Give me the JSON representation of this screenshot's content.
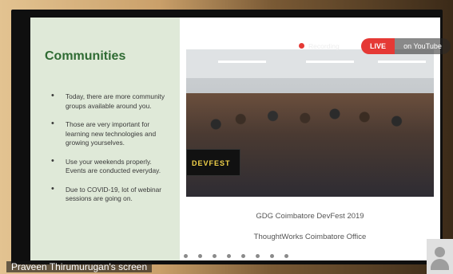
{
  "slide": {
    "title": "Communities",
    "bullets": [
      "Today, there are more community groups available around you.",
      "Those are very important for learning new technologies and growing yourselves.",
      "Use your weekends properly. Events are conducted everyday.",
      "Due to COVID-19, lot of webinar sessions are going on."
    ],
    "banner_text": "DEVFEST",
    "captions": [
      "GDG Coimbatore DevFest 2019",
      "ThoughtWorks Coimbatore Office"
    ],
    "accent_color": "#2f6b33",
    "panel_color": "#dfe9d8"
  },
  "stream": {
    "recording_label": "Recording",
    "live_label": "LIVE",
    "platform_label": "on YouTube",
    "live_color": "#e53935"
  },
  "pagination": {
    "dot_count": 8
  },
  "footer": {
    "screen_label": "Praveen Thirumurugan's screen",
    "avatar_icon": "person-avatar-icon"
  }
}
